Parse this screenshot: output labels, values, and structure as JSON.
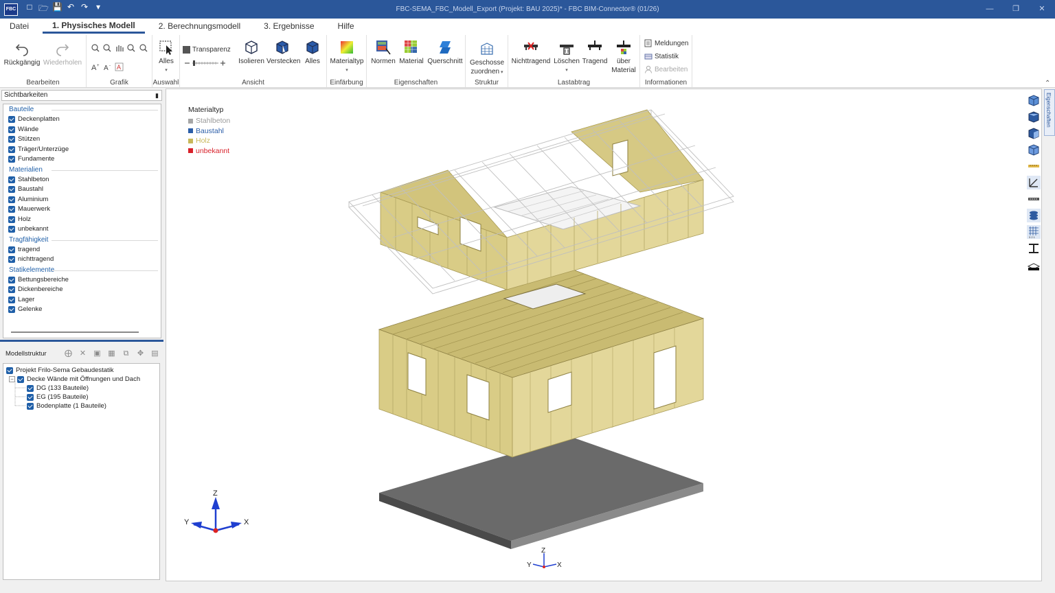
{
  "titlebar": {
    "logo": "FBC",
    "title": "FBC-SEMA_FBC_Modell_Export (Projekt: BAU 2025)*  -  FBC BIM-Connector® (01/26)",
    "minimize": "—",
    "restore": "❐",
    "close": "✕"
  },
  "menu": {
    "tabs": [
      {
        "label": "Datei"
      },
      {
        "label": "1. Physisches Modell"
      },
      {
        "label": "2. Berechnungsmodell"
      },
      {
        "label": "3. Ergebnisse"
      },
      {
        "label": "Hilfe"
      }
    ]
  },
  "ribbon": {
    "bearbeiten": {
      "label": "Bearbeiten",
      "undo": "Rückgängig",
      "redo": "Wiederholen"
    },
    "grafik": {
      "label": "Grafik"
    },
    "auswahl": {
      "label": "Auswahl",
      "alles": "Alles"
    },
    "ansicht": {
      "label": "Ansicht",
      "transparenz": "Transparenz",
      "isolieren": "Isolieren",
      "verstecken": "Verstecken",
      "alles": "Alles"
    },
    "einfaerbung": {
      "label": "Einfärbung",
      "materialtyp": "Materialtyp"
    },
    "eigenschaften": {
      "label": "Eigenschaften",
      "normen": "Normen",
      "material": "Material",
      "querschnitt": "Querschnitt"
    },
    "struktur": {
      "label": "Struktur",
      "geschosse_1": "Geschosse",
      "geschosse_2": "zuordnen"
    },
    "lastabtrag": {
      "label": "Lastabtrag",
      "nichttragend": "Nichttragend",
      "loeschen": "Löschen",
      "tragend": "Tragend",
      "ueber_1": "über",
      "ueber_2": "Material"
    },
    "informationen": {
      "label": "Informationen",
      "meldungen": "Meldungen",
      "statistik": "Statistik",
      "bearbeiten": "Bearbeiten"
    }
  },
  "visibility": {
    "header": "Sichtbarkeiten",
    "sections": [
      {
        "title": "Bauteile",
        "items": [
          "Deckenplatten",
          "Wände",
          "Stützen",
          "Träger/Unterzüge",
          "Fundamente"
        ]
      },
      {
        "title": "Materialien",
        "items": [
          "Stahlbeton",
          "Baustahl",
          "Aluminium",
          "Mauerwerk",
          "Holz",
          "unbekannt"
        ]
      },
      {
        "title": "Tragfähigkeit",
        "items": [
          "tragend",
          "nichttragend"
        ]
      },
      {
        "title": "Statikelemente",
        "items": [
          "Bettungsbereiche",
          "Dickenbereiche",
          "Lager",
          "Gelenke"
        ]
      }
    ]
  },
  "structure": {
    "header": "Modellstruktur",
    "root": "Projekt Frilo-Sema Gebaudestatik",
    "model": "Decke Wände mit Öffnungen und Dach",
    "children": [
      "DG (133 Bauteile)",
      "EG (195 Bauteile)",
      "Bodenplatte (1 Bauteile)"
    ]
  },
  "legend": {
    "title": "Materialtyp",
    "entries": [
      {
        "label": "Stahlbeton",
        "color": "#a6a6a6"
      },
      {
        "label": "Baustahl",
        "color": "#2b5ea8"
      },
      {
        "label": "Holz",
        "color": "#c8b85a"
      },
      {
        "label": "unbekannt",
        "color": "#d8212a"
      }
    ]
  },
  "axes": {
    "z": "Z",
    "y": "Y",
    "x": "X"
  },
  "side_tab": "Eigenschaften",
  "colors": {
    "accent": "#2b579a",
    "wood": "#d7ca84",
    "slab": "#6e6e6e"
  }
}
